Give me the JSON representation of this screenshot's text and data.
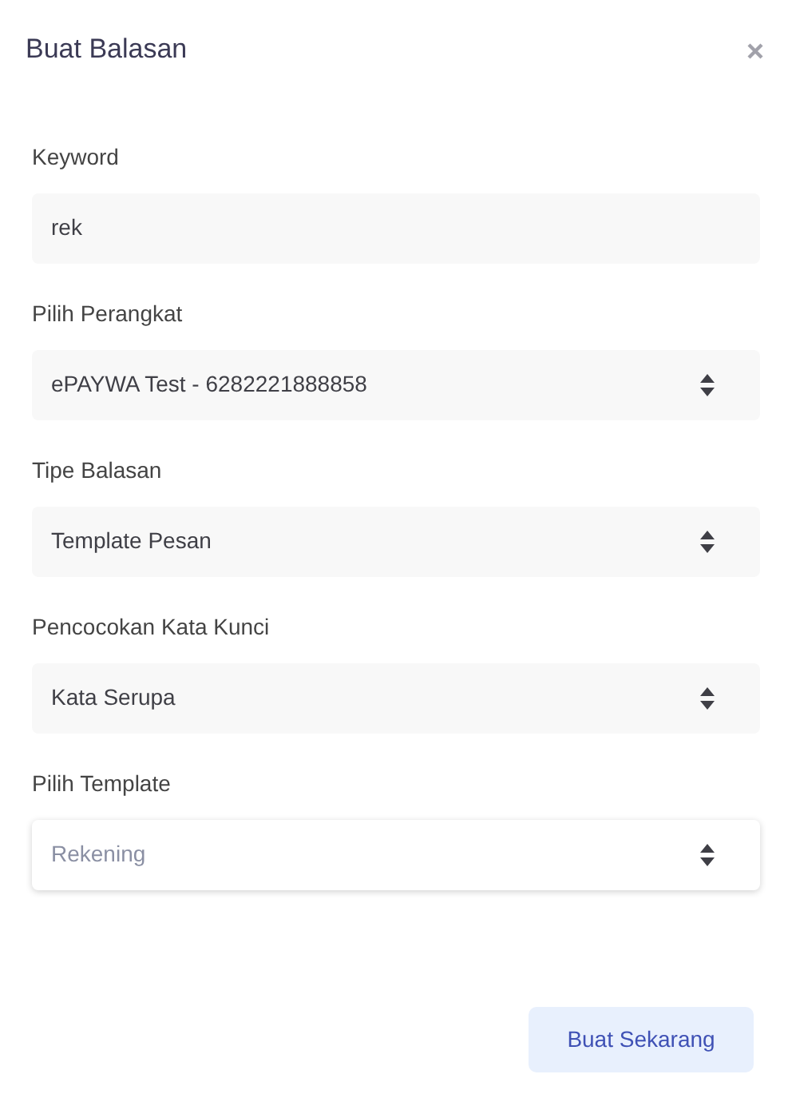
{
  "dialog": {
    "title": "Buat Balasan"
  },
  "fields": [
    {
      "label": "Keyword",
      "kind": "text",
      "value": "rek",
      "focused": false
    },
    {
      "label": "Pilih Perangkat",
      "kind": "select",
      "value": "ePAYWA Test - 6282221888858",
      "focused": false
    },
    {
      "label": "Tipe Balasan",
      "kind": "select",
      "value": "Template Pesan",
      "focused": false
    },
    {
      "label": "Pencocokan Kata Kunci",
      "kind": "select",
      "value": "Kata Serupa",
      "focused": false
    },
    {
      "label": "Pilih Template",
      "kind": "select",
      "value": "Rekening",
      "focused": true
    }
  ],
  "submit_button": "Buat Sekarang"
}
